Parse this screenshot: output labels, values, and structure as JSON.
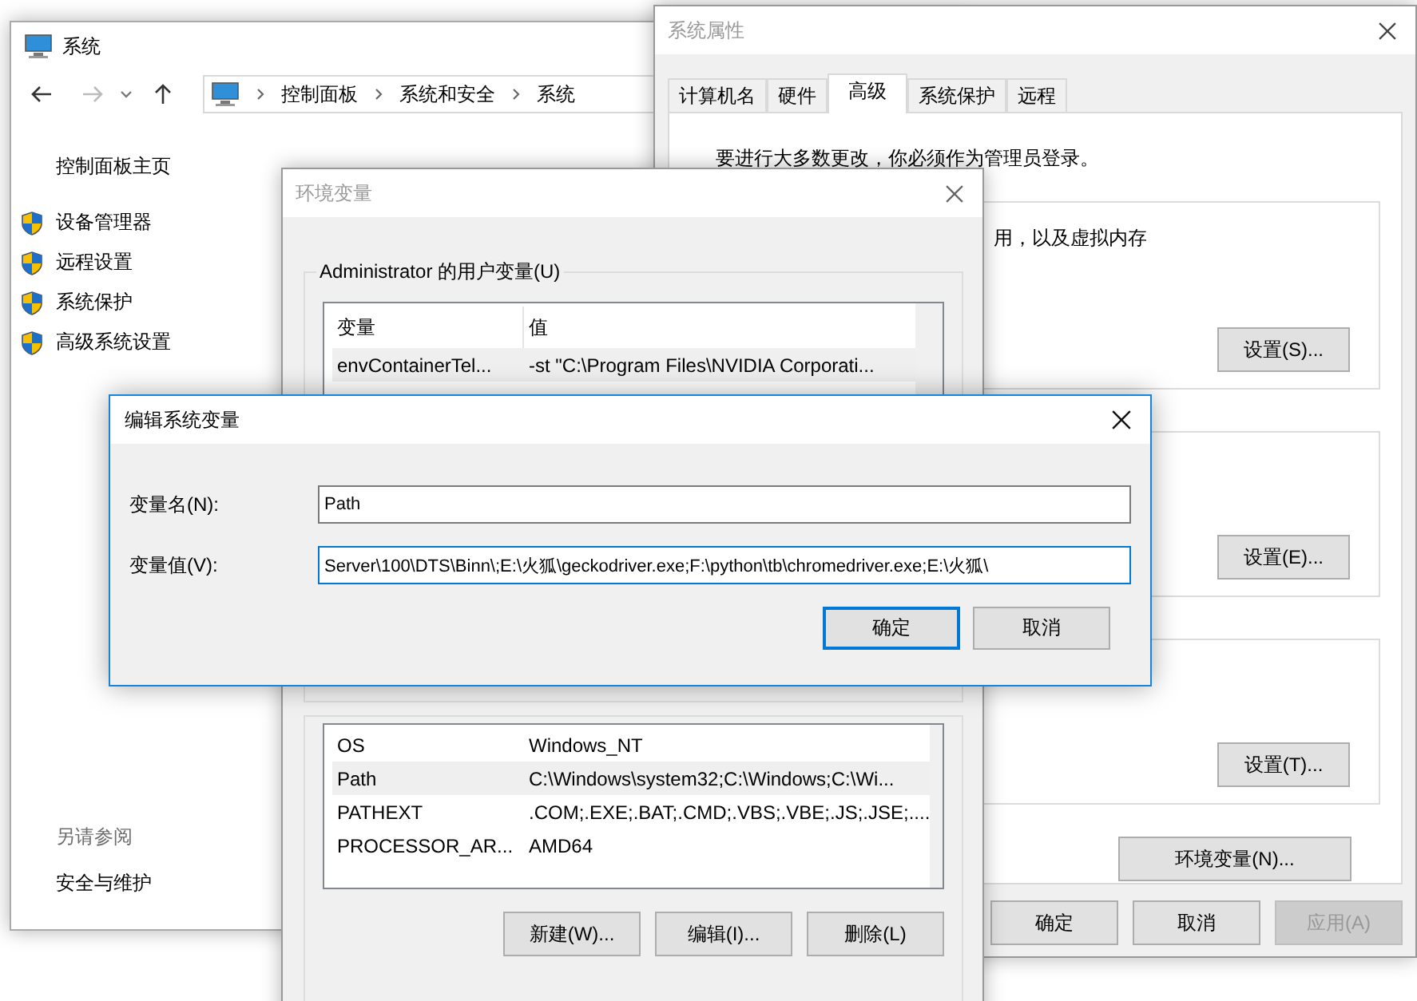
{
  "system_window": {
    "title": "系统",
    "breadcrumb": [
      "控制面板",
      "系统和安全",
      "系统"
    ],
    "sidebar_home": "控制面板主页",
    "sidebar_links": [
      "设备管理器",
      "远程设置",
      "系统保护",
      "高级系统设置"
    ],
    "see_also_heading": "另请参阅",
    "see_also_links": [
      "安全与维护"
    ]
  },
  "system_properties": {
    "title": "系统属性",
    "tabs": [
      {
        "label": "计算机名",
        "selected": false
      },
      {
        "label": "硬件",
        "selected": false
      },
      {
        "label": "高级",
        "selected": true
      },
      {
        "label": "系统保护",
        "selected": false
      },
      {
        "label": "远程",
        "selected": false
      }
    ],
    "notice": "要进行大多数更改，你必须作为管理员登录。",
    "performance_text": "用，以及虚拟内存",
    "settings_buttons": [
      "设置(S)...",
      "设置(E)...",
      "设置(T)..."
    ],
    "env_button": "环境变量(N)...",
    "footer_buttons": [
      {
        "label": "确定",
        "disabled": false
      },
      {
        "label": "取消",
        "disabled": false
      },
      {
        "label": "应用(A)",
        "disabled": true
      }
    ]
  },
  "environment_variables": {
    "title": "环境变量",
    "user_group": "Administrator 的用户变量(U)",
    "user_columns": [
      "变量",
      "值"
    ],
    "user_rows": [
      {
        "name": "envContainerTel...",
        "value": "-st \"C:\\Program Files\\NVIDIA Corporati...",
        "selected": true
      }
    ],
    "system_rows": [
      {
        "name": "OS",
        "value": "Windows_NT",
        "selected": false
      },
      {
        "name": "Path",
        "value": "C:\\Windows\\system32;C:\\Windows;C:\\Wi...",
        "selected": true
      },
      {
        "name": "PATHEXT",
        "value": ".COM;.EXE;.BAT;.CMD;.VBS;.VBE;.JS;.JSE;....",
        "selected": false
      },
      {
        "name": "PROCESSOR_AR...",
        "value": "AMD64",
        "selected": false
      }
    ],
    "buttons": [
      "新建(W)...",
      "编辑(I)...",
      "删除(L)"
    ]
  },
  "edit_dialog": {
    "title": "编辑系统变量",
    "name_label": "变量名(N):",
    "name_value": "Path",
    "value_label": "变量值(V):",
    "value_value": "Server\\100\\DTS\\Binn\\;E:\\火狐\\geckodriver.exe;F:\\python\\tb\\chromedriver.exe;E:\\火狐\\",
    "buttons": [
      {
        "label": "确定",
        "default": true
      },
      {
        "label": "取消",
        "default": false
      }
    ]
  }
}
